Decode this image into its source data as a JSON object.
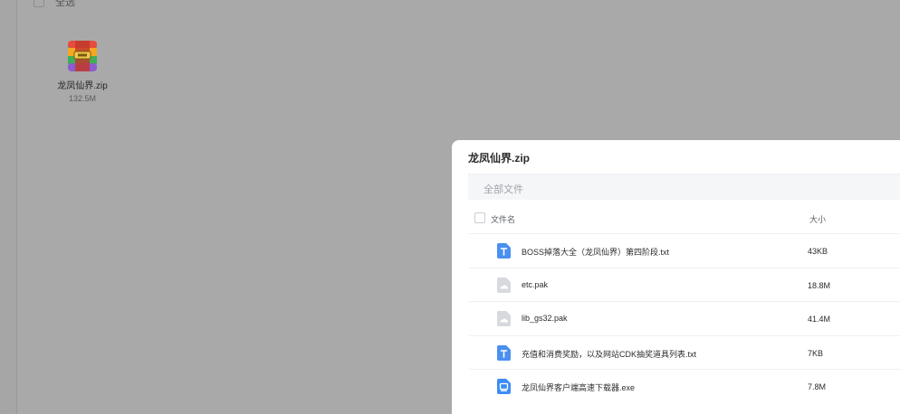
{
  "background": {
    "select_all_label": "全选",
    "file": {
      "name": "龙凤仙界.zip",
      "size": "132.5M",
      "icon": "zip-archive-icon"
    }
  },
  "panel": {
    "title": "龙凤仙界.zip",
    "breadcrumb": "全部文件",
    "columns": {
      "name": "文件名",
      "size": "大小"
    },
    "files": [
      {
        "name": "BOSS掉落大全（龙凤仙界）第四阶段.txt",
        "size": "43KB",
        "icon": "txt-file-icon"
      },
      {
        "name": "etc.pak",
        "size": "18.8M",
        "icon": "generic-file-icon"
      },
      {
        "name": "lib_gs32.pak",
        "size": "41.4M",
        "icon": "generic-file-icon"
      },
      {
        "name": "充值和消费奖励，以及网站CDK抽奖道具列表.txt",
        "size": "7KB",
        "icon": "txt-file-icon"
      },
      {
        "name": "龙凤仙界客户端高速下载器.exe",
        "size": "7.8M",
        "icon": "exe-file-icon"
      }
    ]
  },
  "colors": {
    "txt_icon": "#4a90f0",
    "generic_icon": "#d6d9de",
    "exe_icon": "#3d8cf5",
    "panel_bg": "#ffffff",
    "overlay": "#a9a9a9"
  }
}
